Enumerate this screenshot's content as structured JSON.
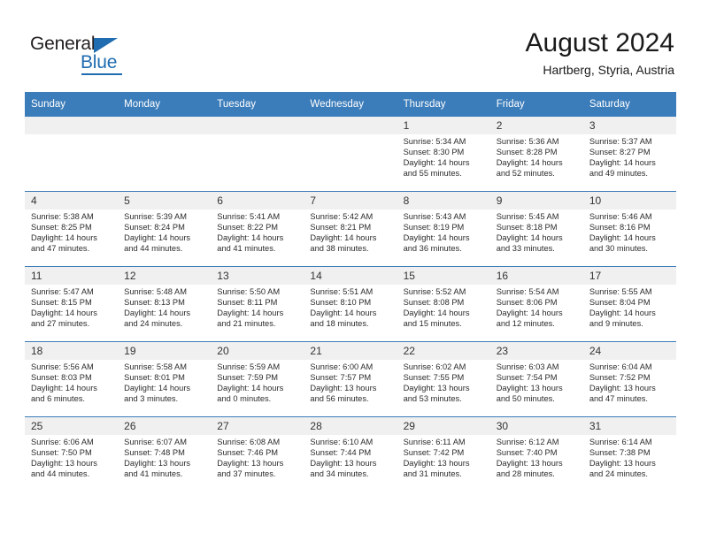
{
  "brand": {
    "name_top": "General",
    "name_bottom": "Blue"
  },
  "header": {
    "title": "August 2024",
    "subtitle": "Hartberg, Styria, Austria"
  },
  "colors": {
    "header_blue": "#3b7cba",
    "brand_blue": "#1f6cb0",
    "daynum_band": "#f0f0f0"
  },
  "calendar": {
    "weekday_headers": [
      "Sunday",
      "Monday",
      "Tuesday",
      "Wednesday",
      "Thursday",
      "Friday",
      "Saturday"
    ],
    "labels": {
      "sunrise": "Sunrise:",
      "sunset": "Sunset:",
      "daylight": "Daylight:"
    },
    "weeks": [
      [
        {
          "day": "",
          "empty": true
        },
        {
          "day": "",
          "empty": true
        },
        {
          "day": "",
          "empty": true
        },
        {
          "day": "",
          "empty": true
        },
        {
          "day": "1",
          "sunrise": "Sunrise: 5:34 AM",
          "sunset": "Sunset: 8:30 PM",
          "daylight_1": "Daylight: 14 hours",
          "daylight_2": "and 55 minutes."
        },
        {
          "day": "2",
          "sunrise": "Sunrise: 5:36 AM",
          "sunset": "Sunset: 8:28 PM",
          "daylight_1": "Daylight: 14 hours",
          "daylight_2": "and 52 minutes."
        },
        {
          "day": "3",
          "sunrise": "Sunrise: 5:37 AM",
          "sunset": "Sunset: 8:27 PM",
          "daylight_1": "Daylight: 14 hours",
          "daylight_2": "and 49 minutes."
        }
      ],
      [
        {
          "day": "4",
          "sunrise": "Sunrise: 5:38 AM",
          "sunset": "Sunset: 8:25 PM",
          "daylight_1": "Daylight: 14 hours",
          "daylight_2": "and 47 minutes."
        },
        {
          "day": "5",
          "sunrise": "Sunrise: 5:39 AM",
          "sunset": "Sunset: 8:24 PM",
          "daylight_1": "Daylight: 14 hours",
          "daylight_2": "and 44 minutes."
        },
        {
          "day": "6",
          "sunrise": "Sunrise: 5:41 AM",
          "sunset": "Sunset: 8:22 PM",
          "daylight_1": "Daylight: 14 hours",
          "daylight_2": "and 41 minutes."
        },
        {
          "day": "7",
          "sunrise": "Sunrise: 5:42 AM",
          "sunset": "Sunset: 8:21 PM",
          "daylight_1": "Daylight: 14 hours",
          "daylight_2": "and 38 minutes."
        },
        {
          "day": "8",
          "sunrise": "Sunrise: 5:43 AM",
          "sunset": "Sunset: 8:19 PM",
          "daylight_1": "Daylight: 14 hours",
          "daylight_2": "and 36 minutes."
        },
        {
          "day": "9",
          "sunrise": "Sunrise: 5:45 AM",
          "sunset": "Sunset: 8:18 PM",
          "daylight_1": "Daylight: 14 hours",
          "daylight_2": "and 33 minutes."
        },
        {
          "day": "10",
          "sunrise": "Sunrise: 5:46 AM",
          "sunset": "Sunset: 8:16 PM",
          "daylight_1": "Daylight: 14 hours",
          "daylight_2": "and 30 minutes."
        }
      ],
      [
        {
          "day": "11",
          "sunrise": "Sunrise: 5:47 AM",
          "sunset": "Sunset: 8:15 PM",
          "daylight_1": "Daylight: 14 hours",
          "daylight_2": "and 27 minutes."
        },
        {
          "day": "12",
          "sunrise": "Sunrise: 5:48 AM",
          "sunset": "Sunset: 8:13 PM",
          "daylight_1": "Daylight: 14 hours",
          "daylight_2": "and 24 minutes."
        },
        {
          "day": "13",
          "sunrise": "Sunrise: 5:50 AM",
          "sunset": "Sunset: 8:11 PM",
          "daylight_1": "Daylight: 14 hours",
          "daylight_2": "and 21 minutes."
        },
        {
          "day": "14",
          "sunrise": "Sunrise: 5:51 AM",
          "sunset": "Sunset: 8:10 PM",
          "daylight_1": "Daylight: 14 hours",
          "daylight_2": "and 18 minutes."
        },
        {
          "day": "15",
          "sunrise": "Sunrise: 5:52 AM",
          "sunset": "Sunset: 8:08 PM",
          "daylight_1": "Daylight: 14 hours",
          "daylight_2": "and 15 minutes."
        },
        {
          "day": "16",
          "sunrise": "Sunrise: 5:54 AM",
          "sunset": "Sunset: 8:06 PM",
          "daylight_1": "Daylight: 14 hours",
          "daylight_2": "and 12 minutes."
        },
        {
          "day": "17",
          "sunrise": "Sunrise: 5:55 AM",
          "sunset": "Sunset: 8:04 PM",
          "daylight_1": "Daylight: 14 hours",
          "daylight_2": "and 9 minutes."
        }
      ],
      [
        {
          "day": "18",
          "sunrise": "Sunrise: 5:56 AM",
          "sunset": "Sunset: 8:03 PM",
          "daylight_1": "Daylight: 14 hours",
          "daylight_2": "and 6 minutes."
        },
        {
          "day": "19",
          "sunrise": "Sunrise: 5:58 AM",
          "sunset": "Sunset: 8:01 PM",
          "daylight_1": "Daylight: 14 hours",
          "daylight_2": "and 3 minutes."
        },
        {
          "day": "20",
          "sunrise": "Sunrise: 5:59 AM",
          "sunset": "Sunset: 7:59 PM",
          "daylight_1": "Daylight: 14 hours",
          "daylight_2": "and 0 minutes."
        },
        {
          "day": "21",
          "sunrise": "Sunrise: 6:00 AM",
          "sunset": "Sunset: 7:57 PM",
          "daylight_1": "Daylight: 13 hours",
          "daylight_2": "and 56 minutes."
        },
        {
          "day": "22",
          "sunrise": "Sunrise: 6:02 AM",
          "sunset": "Sunset: 7:55 PM",
          "daylight_1": "Daylight: 13 hours",
          "daylight_2": "and 53 minutes."
        },
        {
          "day": "23",
          "sunrise": "Sunrise: 6:03 AM",
          "sunset": "Sunset: 7:54 PM",
          "daylight_1": "Daylight: 13 hours",
          "daylight_2": "and 50 minutes."
        },
        {
          "day": "24",
          "sunrise": "Sunrise: 6:04 AM",
          "sunset": "Sunset: 7:52 PM",
          "daylight_1": "Daylight: 13 hours",
          "daylight_2": "and 47 minutes."
        }
      ],
      [
        {
          "day": "25",
          "sunrise": "Sunrise: 6:06 AM",
          "sunset": "Sunset: 7:50 PM",
          "daylight_1": "Daylight: 13 hours",
          "daylight_2": "and 44 minutes."
        },
        {
          "day": "26",
          "sunrise": "Sunrise: 6:07 AM",
          "sunset": "Sunset: 7:48 PM",
          "daylight_1": "Daylight: 13 hours",
          "daylight_2": "and 41 minutes."
        },
        {
          "day": "27",
          "sunrise": "Sunrise: 6:08 AM",
          "sunset": "Sunset: 7:46 PM",
          "daylight_1": "Daylight: 13 hours",
          "daylight_2": "and 37 minutes."
        },
        {
          "day": "28",
          "sunrise": "Sunrise: 6:10 AM",
          "sunset": "Sunset: 7:44 PM",
          "daylight_1": "Daylight: 13 hours",
          "daylight_2": "and 34 minutes."
        },
        {
          "day": "29",
          "sunrise": "Sunrise: 6:11 AM",
          "sunset": "Sunset: 7:42 PM",
          "daylight_1": "Daylight: 13 hours",
          "daylight_2": "and 31 minutes."
        },
        {
          "day": "30",
          "sunrise": "Sunrise: 6:12 AM",
          "sunset": "Sunset: 7:40 PM",
          "daylight_1": "Daylight: 13 hours",
          "daylight_2": "and 28 minutes."
        },
        {
          "day": "31",
          "sunrise": "Sunrise: 6:14 AM",
          "sunset": "Sunset: 7:38 PM",
          "daylight_1": "Daylight: 13 hours",
          "daylight_2": "and 24 minutes."
        }
      ]
    ]
  }
}
